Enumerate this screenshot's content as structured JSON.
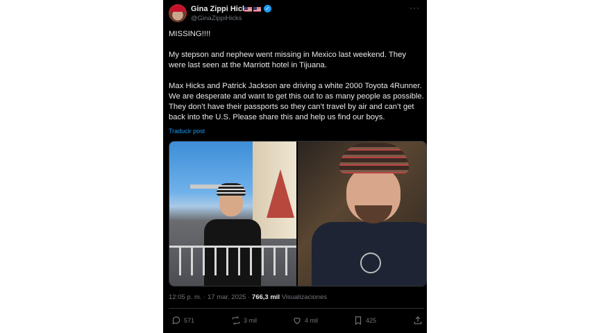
{
  "author": {
    "name": "Gina Zippi Hicks",
    "flags": [
      "us-flag",
      "us-flag"
    ],
    "verified": true,
    "handle": "@GinaZippiHicks",
    "more_icon": "more-icon"
  },
  "post": {
    "paragraphs": [
      "MISSING!!!!",
      "My stepson and nephew went missing in Mexico last weekend.  They were last seen at the Marriott hotel in Tijuana.",
      "Max Hicks and Patrick Jackson are driving a white 2000 Toyota 4Runner.  We are desperate and want to get this out to as many people as possible.  They don’t have their passports so they can’t travel by air and can’t get back into the U.S.  Please share this and help us find our boys."
    ],
    "translate_label": "Traducir post"
  },
  "meta": {
    "time": "12:05 p. m.",
    "separator": " · ",
    "date": "17 mar. 2025",
    "views_count": "766,3 mil",
    "views_label": "Visualizaciones"
  },
  "actions": {
    "reply": {
      "icon": "reply-icon",
      "count": "571"
    },
    "repost": {
      "icon": "repost-icon",
      "count": "3 mil"
    },
    "like": {
      "icon": "heart-icon",
      "count": "4 mil"
    },
    "bookmark": {
      "icon": "bookmark-icon",
      "count": "425"
    },
    "share": {
      "icon": "share-icon"
    }
  },
  "colors": {
    "background": "#000000",
    "text": "#e7e9ea",
    "muted": "#71767b",
    "link": "#1d9bf0"
  }
}
